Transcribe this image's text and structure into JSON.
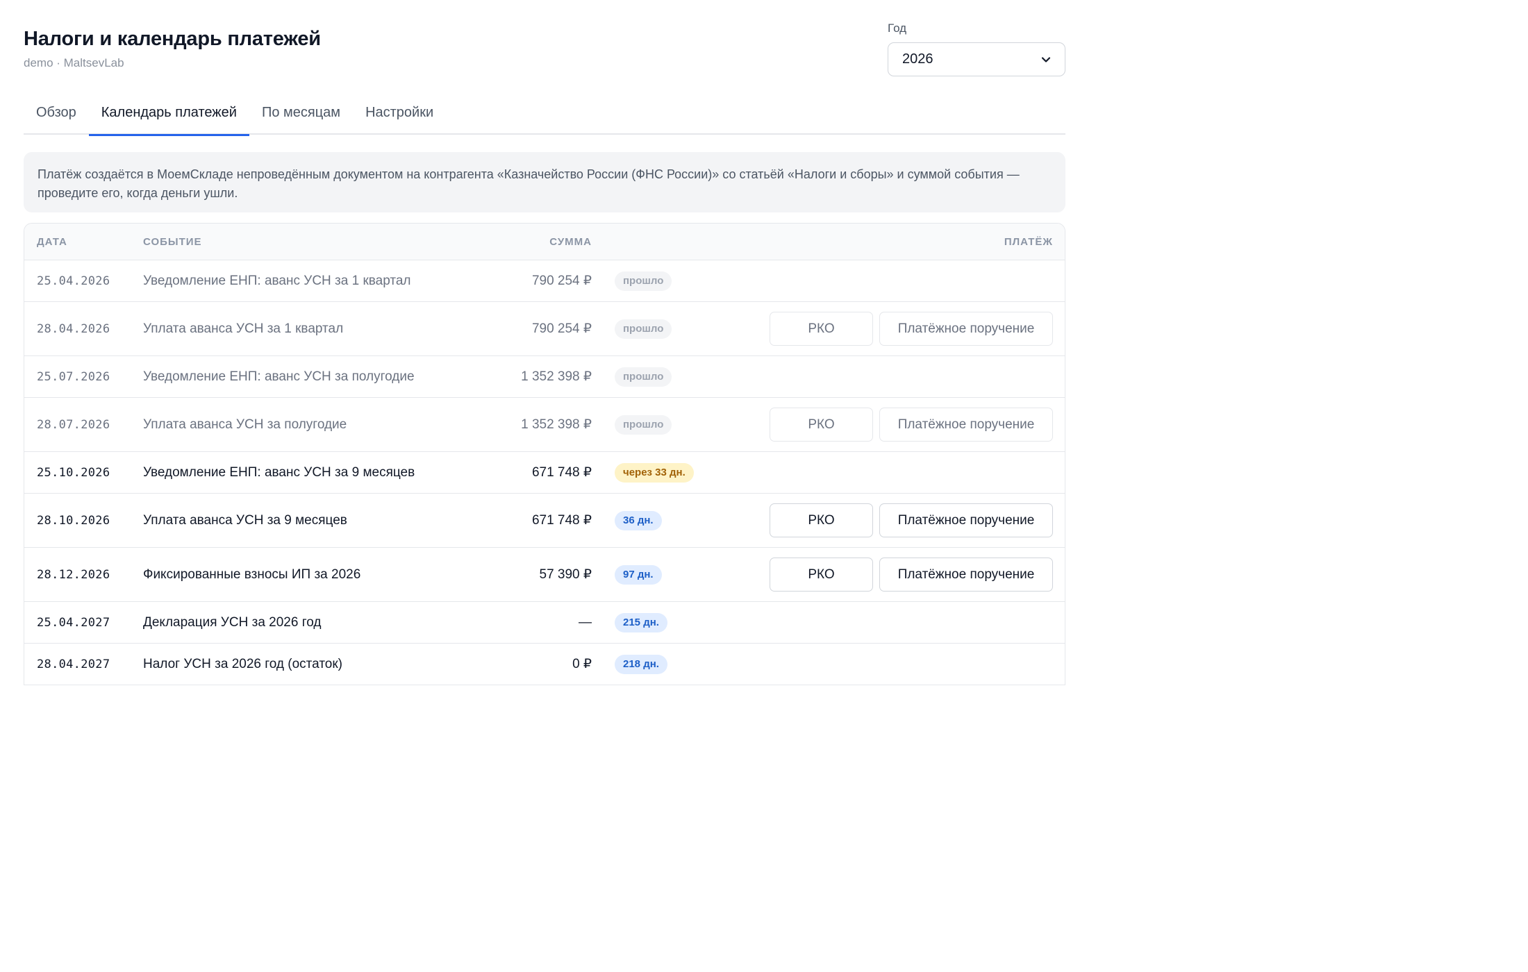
{
  "header": {
    "title": "Налоги и календарь платежей",
    "subtitle": "demo · MaltsevLab"
  },
  "year": {
    "label": "Год",
    "selected": "2026"
  },
  "tabs": [
    {
      "label": "Обзор",
      "active": false
    },
    {
      "label": "Календарь платежей",
      "active": true
    },
    {
      "label": "По месяцам",
      "active": false
    },
    {
      "label": "Настройки",
      "active": false
    }
  ],
  "info": "Платёж создаётся в МоемСкладе непроведённым документом на контрагента «Казначейство России (ФНС России)» со статьёй «Налоги и сборы» и суммой события — проведите его, когда деньги ушли.",
  "table": {
    "columns": {
      "date": "Дата",
      "event": "Событие",
      "sum": "Сумма",
      "payment": "Платёж"
    },
    "rows": [
      {
        "date": "25.04.2026",
        "event": "Уведомление ЕНП: аванс УСН за 1 квартал",
        "sum": "790 254 ₽",
        "status": "прошло",
        "status_kind": "past",
        "has_payment": false
      },
      {
        "date": "28.04.2026",
        "event": "Уплата аванса УСН за 1 квартал",
        "sum": "790 254 ₽",
        "status": "прошло",
        "status_kind": "past",
        "has_payment": true
      },
      {
        "date": "25.07.2026",
        "event": "Уведомление ЕНП: аванс УСН за полугодие",
        "sum": "1 352 398 ₽",
        "status": "прошло",
        "status_kind": "past",
        "has_payment": false
      },
      {
        "date": "28.07.2026",
        "event": "Уплата аванса УСН за полугодие",
        "sum": "1 352 398 ₽",
        "status": "прошло",
        "status_kind": "past",
        "has_payment": true
      },
      {
        "date": "25.10.2026",
        "event": "Уведомление ЕНП: аванс УСН за 9 месяцев",
        "sum": "671 748 ₽",
        "status": "через 33 дн.",
        "status_kind": "soon",
        "has_payment": false
      },
      {
        "date": "28.10.2026",
        "event": "Уплата аванса УСН за 9 месяцев",
        "sum": "671 748 ₽",
        "status": "36 дн.",
        "status_kind": "later",
        "has_payment": true
      },
      {
        "date": "28.12.2026",
        "event": "Фиксированные взносы ИП за 2026",
        "sum": "57 390 ₽",
        "status": "97 дн.",
        "status_kind": "later",
        "has_payment": true
      },
      {
        "date": "25.04.2027",
        "event": "Декларация УСН за 2026 год",
        "sum": "—",
        "status": "215 дн.",
        "status_kind": "later",
        "has_payment": false
      },
      {
        "date": "28.04.2027",
        "event": "Налог УСН за 2026 год (остаток)",
        "sum": "0 ₽",
        "status": "218 дн.",
        "status_kind": "later",
        "has_payment": false
      }
    ],
    "buttons": {
      "rko": "РКО",
      "payment_order": "Платёжное поручение"
    }
  },
  "icons": {
    "year_dropdown": "chevron-down-icon"
  }
}
